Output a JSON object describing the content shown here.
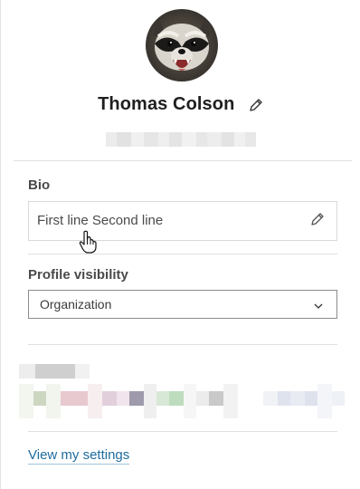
{
  "profile": {
    "name": "Thomas Colson",
    "avatar": "raccoon-avatar",
    "email_redacted": true
  },
  "bio": {
    "label": "Bio",
    "value": "First line Second line",
    "edit_icon": "pencil-icon"
  },
  "visibility": {
    "label": "Profile visibility",
    "selected": "Organization",
    "dropdown_icon": "chevron-down-icon"
  },
  "links": {
    "settings": "View my settings"
  },
  "colors": {
    "link": "#1f6c9e",
    "divider": "#e0e0e0",
    "text": "#2b2b2b"
  }
}
